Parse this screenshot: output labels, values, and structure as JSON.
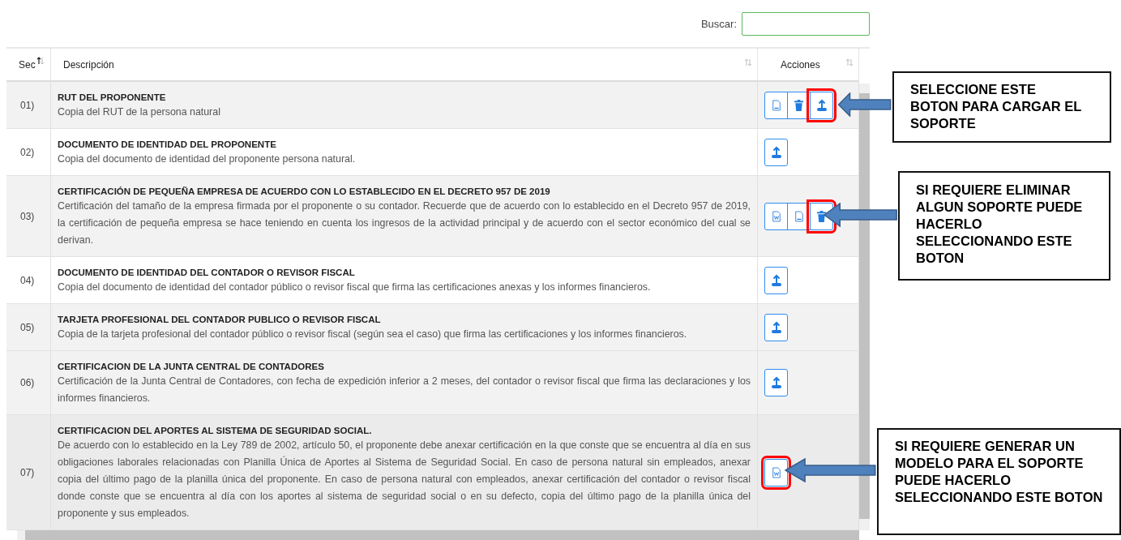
{
  "search": {
    "label": "Buscar:"
  },
  "table": {
    "columns": [
      {
        "label": "Sec",
        "sorted": true
      },
      {
        "label": "Descripción",
        "sorted": false
      },
      {
        "label": "Acciones",
        "sorted": false
      }
    ],
    "rows": [
      {
        "sec": "01)",
        "title": "RUT DEL PROPONENTE",
        "description": "Copia del RUT de la persona natural",
        "actions": [
          {
            "kind": "pdf",
            "highlighted": false
          },
          {
            "kind": "delete",
            "highlighted": false
          },
          {
            "kind": "upload",
            "highlighted": true
          }
        ]
      },
      {
        "sec": "02)",
        "title": "DOCUMENTO DE IDENTIDAD DEL PROPONENTE",
        "description": "Copia del documento de identidad del proponente persona natural.",
        "actions": [
          {
            "kind": "upload",
            "highlighted": false
          }
        ]
      },
      {
        "sec": "03)",
        "title": "CERTIFICACIÓN DE PEQUEÑA EMPRESA DE ACUERDO CON LO ESTABLECIDO EN EL DECRETO 957 DE 2019",
        "description": "Certificación del tamaño de la empresa firmada por el proponente o su contador. Recuerde que de acuerdo con lo establecido en el Decreto 957 de 2019, la certificación de pequeña empresa se hace teniendo en cuenta los ingresos de la actividad principal y de acuerdo con el sector económico del cual se derivan.",
        "actions": [
          {
            "kind": "word",
            "highlighted": false
          },
          {
            "kind": "pdf",
            "highlighted": false
          },
          {
            "kind": "delete",
            "highlighted": true
          }
        ]
      },
      {
        "sec": "04)",
        "title": "DOCUMENTO DE IDENTIDAD DEL CONTADOR O REVISOR FISCAL",
        "description": "Copia del documento de identidad del contador público o revisor fiscal que firma las certificaciones anexas y los informes financieros.",
        "actions": [
          {
            "kind": "upload",
            "highlighted": false
          }
        ]
      },
      {
        "sec": "05)",
        "title": "TARJETA PROFESIONAL DEL CONTADOR PUBLICO O REVISOR FISCAL",
        "description": "Copia de la tarjeta profesional del contador público o revisor fiscal (según sea el caso) que firma las certificaciones y los informes financieros.",
        "actions": [
          {
            "kind": "upload",
            "highlighted": false
          }
        ]
      },
      {
        "sec": "06)",
        "title": "CERTIFICACION DE LA JUNTA CENTRAL DE CONTADORES",
        "description": "Certificación de la Junta Central de Contadores, con fecha de expedición inferior a 2 meses, del contador o revisor fiscal que firma las declaraciones y los informes financieros.",
        "actions": [
          {
            "kind": "upload",
            "highlighted": false
          }
        ]
      },
      {
        "sec": "07)",
        "title": "CERTIFICACION DEL APORTES AL SISTEMA DE SEGURIDAD SOCIAL.",
        "description": "De acuerdo con lo establecido en la Ley 789 de 2002, artículo 50, el proponente debe anexar certificación en la que conste que se encuentra al día en sus obligaciones laborales relacionadas con Planilla Única de Aportes al Sistema de Seguridad Social. En caso de persona natural sin empleados, anexar copia del último pago de la planilla única del proponente. En caso de persona natural con empleados, anexar certificación del contador o revisor fiscal donde conste que se encuentra al día con los aportes al sistema de seguridad social o en su defecto, copia del último pago de la planilla única del proponente y sus empleados.",
        "actions": [
          {
            "kind": "word",
            "highlighted": true
          }
        ]
      }
    ]
  },
  "callouts": [
    {
      "text": "SELECCIONE ESTE BOTON PARA CARGAR EL SOPORTE"
    },
    {
      "text": "SI REQUIERE ELIMINAR ALGUN SOPORTE PUEDE HACERLO SELECCIONANDO ESTE BOTON"
    },
    {
      "text": "SI REQUIERE GENERAR UN MODELO PARA EL SOPORTE PUEDE HACERLO SELECCIONANDO ESTE BOTON"
    }
  ]
}
